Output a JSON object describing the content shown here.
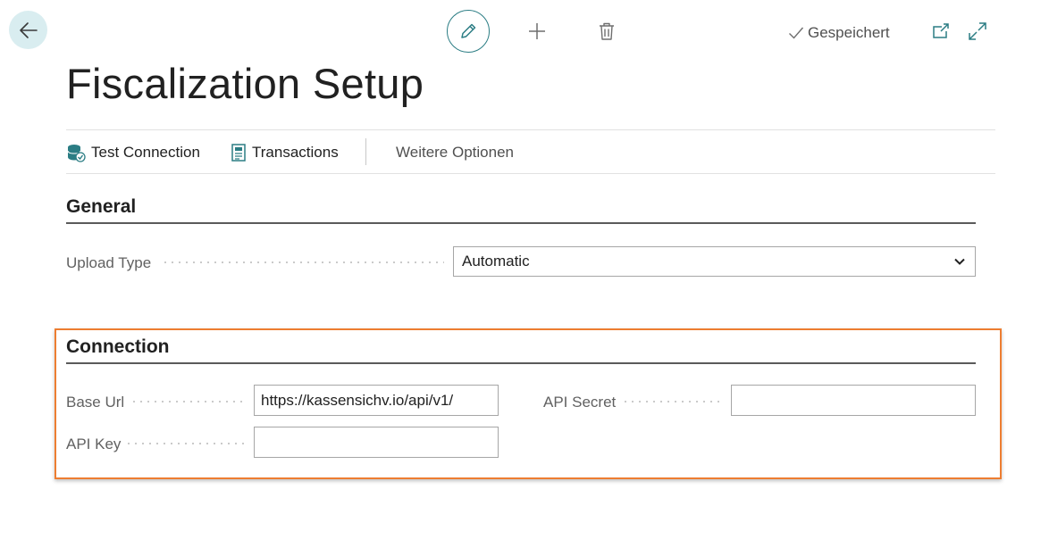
{
  "toolbar": {
    "back_icon": "arrow-left-icon",
    "edit_icon": "pencil-icon",
    "add_icon": "plus-icon",
    "delete_icon": "trash-icon",
    "saved_status": "Gespeichert",
    "popout_icon": "popout-icon",
    "expand_icon": "expand-icon",
    "accent_color": "#2b7d84"
  },
  "page": {
    "title": "Fiscalization Setup"
  },
  "actions": {
    "test_connection": "Test Connection",
    "transactions": "Transactions",
    "more_options": "Weitere Optionen"
  },
  "general": {
    "title": "General",
    "upload_type_label": "Upload Type",
    "upload_type_value": "Automatic"
  },
  "connection": {
    "title": "Connection",
    "base_url_label": "Base Url",
    "base_url_value": "https://kassensichv.io/api/v1/",
    "api_key_label": "API Key",
    "api_key_value": "",
    "api_secret_label": "API Secret",
    "api_secret_value": "",
    "highlight_color": "#ed7d31"
  }
}
